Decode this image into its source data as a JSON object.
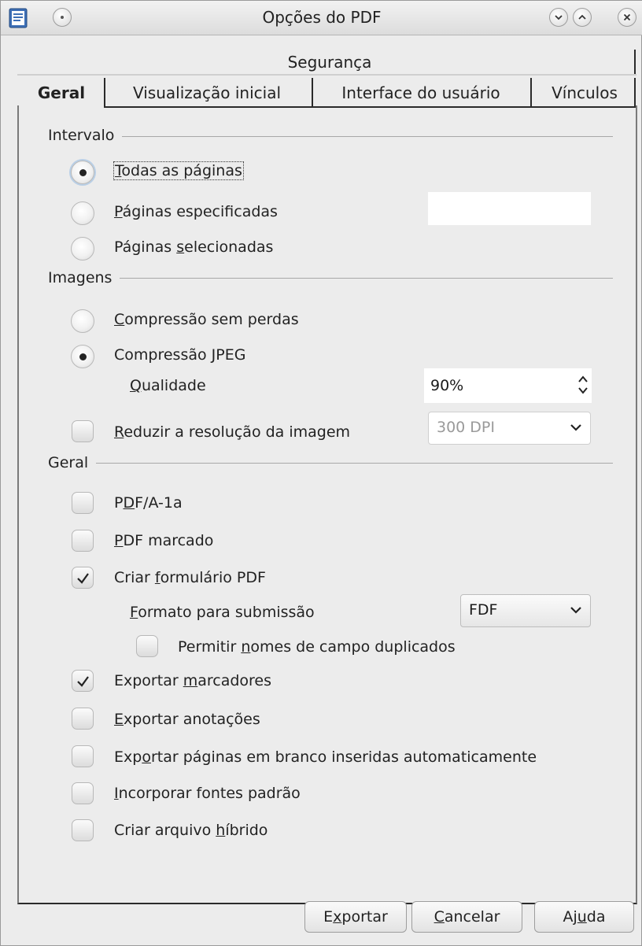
{
  "window": {
    "title": "Opções do PDF"
  },
  "tabs": {
    "row_top": [
      "Segurança"
    ],
    "row_bottom": [
      "Geral",
      "Visualização inicial",
      "Interface do usuário",
      "Vínculos"
    ],
    "active": "Geral"
  },
  "range": {
    "heading": "Intervalo",
    "all_pages": "Todas as páginas",
    "specified_pages": "Páginas especificadas",
    "selected_pages": "Páginas selecionadas",
    "specified_pages_value": "",
    "selected": "all_pages"
  },
  "images": {
    "heading": "Imagens",
    "lossless": "Compressão sem perdas",
    "jpeg": "Compressão JPEG",
    "selected": "jpeg",
    "quality_label": "Qualidade",
    "quality_value": "90%",
    "reduce_label": "Reduzir a resolução da imagem",
    "reduce_checked": false,
    "resolution_value": "300 DPI"
  },
  "general": {
    "heading": "Geral",
    "pdfa": {
      "label": "PDF/A-1a",
      "checked": false
    },
    "tagged": {
      "label": "PDF marcado",
      "checked": false
    },
    "create_form": {
      "label": "Criar formulário PDF",
      "checked": true
    },
    "submit_format_label": "Formato para submissão",
    "submit_format_value": "FDF",
    "allow_duplicates": {
      "label": "Permitir nomes de campo duplicados",
      "checked": false
    },
    "export_bookmarks": {
      "label": "Exportar marcadores",
      "checked": true
    },
    "export_comments": {
      "label": "Exportar anotações",
      "checked": false
    },
    "export_blank_pages": {
      "label": "Exportar páginas em branco inseridas automaticamente",
      "checked": false
    },
    "embed_fonts": {
      "label": "Incorporar fontes padrão",
      "checked": false
    },
    "hybrid": {
      "label": "Criar arquivo híbrido",
      "checked": false
    }
  },
  "buttons": {
    "export": "Exportar",
    "cancel": "Cancelar",
    "help": "Ajuda"
  },
  "icons": {
    "app": "document-icon",
    "window_menu": "window-menu-icon",
    "minimize": "minimize-icon",
    "maximize": "maximize-icon",
    "close": "close-icon"
  }
}
